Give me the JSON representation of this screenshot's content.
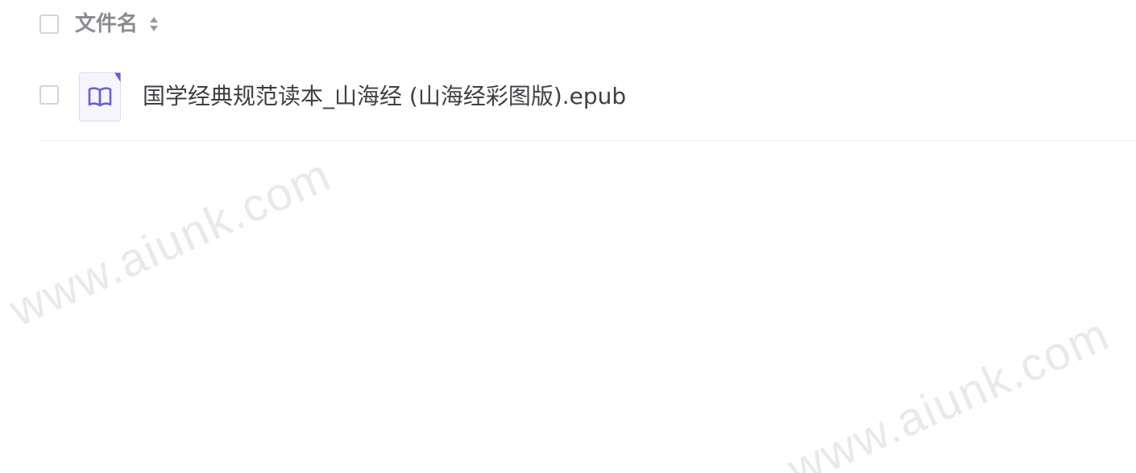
{
  "header": {
    "column_label": "文件名",
    "sort_icon": "sort-up-down-icon"
  },
  "files": [
    {
      "name": "国学经典规范读本_山海经 (山海经彩图版).epub",
      "icon": "book-icon",
      "icon_color": "#6a5fd6"
    }
  ],
  "watermarks": [
    "www.aiunk.com",
    "www.aiunk.com"
  ],
  "colors": {
    "header_text": "#8a8a8f",
    "file_text": "#3f3f46",
    "checkbox_border": "#d4d4d8",
    "icon_accent": "#6a5fd6",
    "watermark": "#e9e9eb"
  }
}
